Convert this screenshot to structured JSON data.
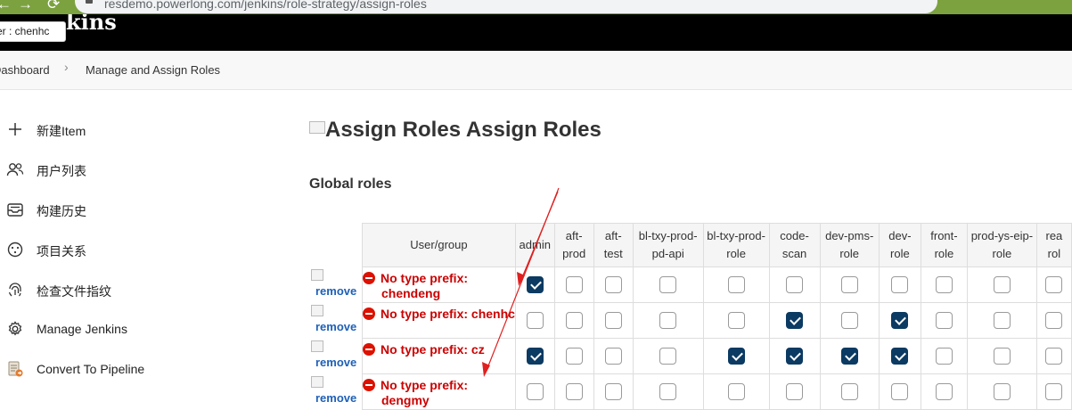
{
  "browser": {
    "back": "←",
    "forward": "→",
    "reload": "⟳",
    "url": "resdemo.powerlong.com/jenkins/role-strategy/assign-roles"
  },
  "header": {
    "brand": "kins",
    "tooltip": "er : chenhc"
  },
  "breadcrumb": {
    "home": "Dashboard",
    "sep": "›",
    "current": "Manage and Assign Roles"
  },
  "sidebar": {
    "items": [
      {
        "label": "新建Item",
        "icon": "plus-icon"
      },
      {
        "label": "用户列表",
        "icon": "people-icon"
      },
      {
        "label": "构建历史",
        "icon": "history-inbox-icon"
      },
      {
        "label": "项目关系",
        "icon": "relation-icon"
      },
      {
        "label": "检查文件指纹",
        "icon": "fingerprint-icon"
      },
      {
        "label": "Manage Jenkins",
        "icon": "gear-icon"
      },
      {
        "label": "Convert To Pipeline",
        "icon": "pipeline-doc-icon"
      }
    ]
  },
  "main": {
    "title_alt": "Assign Roles",
    "title": "Assign Roles",
    "section": "Global roles"
  },
  "table": {
    "user_header": "User/group",
    "roles": [
      [
        "admin"
      ],
      [
        "aft-",
        "prod"
      ],
      [
        "aft-",
        "test"
      ],
      [
        "bl-txy-prod-",
        "pd-api"
      ],
      [
        "bl-txy-prod-",
        "role"
      ],
      [
        "code-",
        "scan"
      ],
      [
        "dev-pms-",
        "role"
      ],
      [
        "dev-",
        "role"
      ],
      [
        "front-",
        "role"
      ],
      [
        "prod-ys-eip-",
        "role"
      ],
      [
        "rea",
        "rol"
      ]
    ],
    "remove_label": "remove",
    "rows": [
      {
        "line1": "No type prefix:",
        "line2": "chendeng",
        "checks": [
          1,
          0,
          0,
          0,
          0,
          0,
          0,
          0,
          0,
          0,
          0
        ]
      },
      {
        "line1": "No type prefix: chenhc",
        "line2": "",
        "checks": [
          0,
          0,
          0,
          0,
          0,
          1,
          0,
          1,
          0,
          0,
          0
        ]
      },
      {
        "line1": "No type prefix: cz",
        "line2": "",
        "checks": [
          1,
          0,
          0,
          0,
          1,
          1,
          1,
          1,
          0,
          0,
          0
        ]
      },
      {
        "line1": "No type prefix:",
        "line2": "dengmy",
        "checks": [
          0,
          0,
          0,
          0,
          0,
          0,
          0,
          0,
          0,
          0,
          0
        ]
      }
    ]
  },
  "colors": {
    "accent": "#0b3a62",
    "warning": "#cc0000",
    "link": "#1e60b8",
    "annotation": "#e02020"
  }
}
